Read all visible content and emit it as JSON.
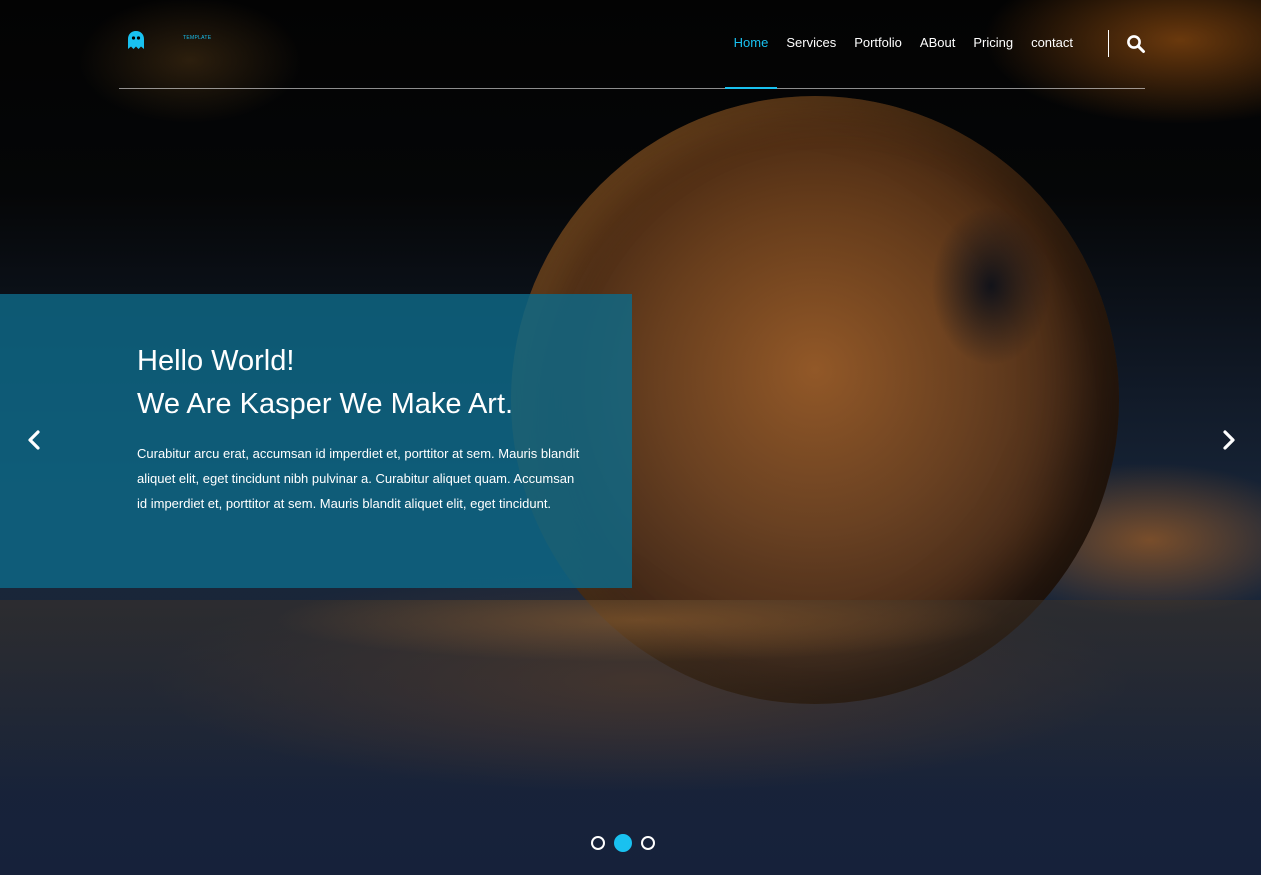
{
  "brand": {
    "logo_text": "TEMPLATE",
    "accent_color": "#19c1f0"
  },
  "nav": {
    "items": [
      {
        "label": "Home",
        "active": true
      },
      {
        "label": "Services"
      },
      {
        "label": "Portfolio"
      },
      {
        "label": "ABout"
      },
      {
        "label": "Pricing"
      },
      {
        "label": "contact"
      }
    ],
    "search_icon": "search-icon"
  },
  "hero": {
    "title_line1": "Hello World!",
    "title_line2": "We Are Kasper We Make Art.",
    "description": "Curabitur arcu erat, accumsan id imperdiet et, porttitor at sem. Mauris blandit aliquet elit, eget tincidunt nibh pulvinar a. Curabitur aliquet quam. Accumsan id imperdiet et, porttitor at sem. Mauris blandit aliquet elit, eget tincidunt.",
    "panel_color": "#0e6987",
    "prev_icon": "chevron-left-icon",
    "next_icon": "chevron-right-icon"
  },
  "slider": {
    "total": 3,
    "active_index": 1
  }
}
